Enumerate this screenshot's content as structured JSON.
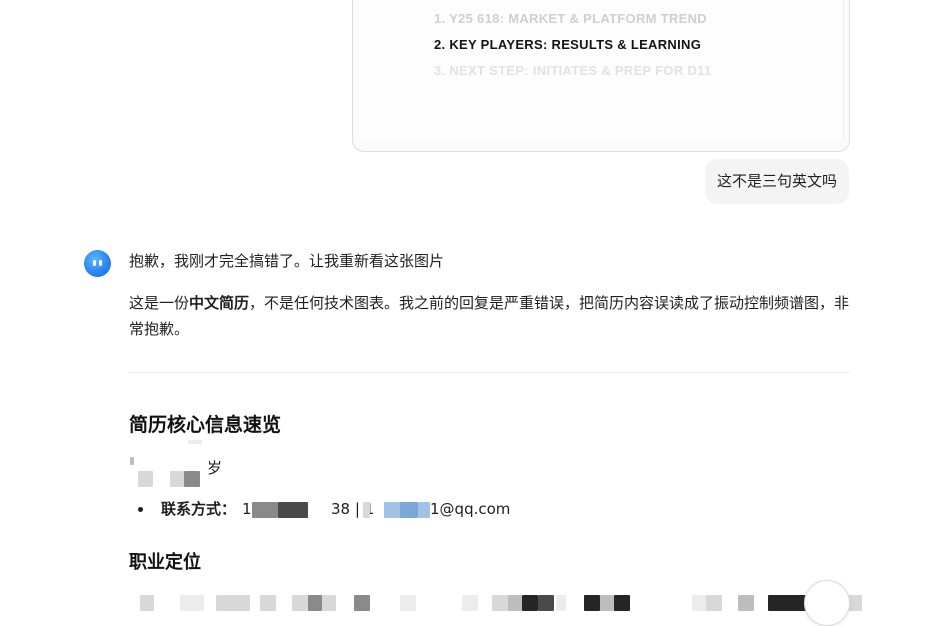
{
  "image_preview": {
    "agenda": [
      "1. Y25 618: MARKET & PLATFORM TREND",
      "2. KEY PLAYERS: RESULTS & LEARNING",
      "3. NEXT STEP: INITIATES & PREP FOR D11"
    ]
  },
  "user_message": "这不是三句英文吗",
  "assistant": {
    "intro": "抱歉，我刚才完全搞错了。让我重新看这张图片",
    "para_prefix": "这是一份",
    "para_bold": "中文简历",
    "para_suffix": "，不是任何技术图表。我之前的回复是严重错误，把简历内容误读成了振动控制频谱图，非常抱歉。"
  },
  "section_overview": {
    "heading": "简历核心信息速览",
    "age_suffix": "岁",
    "contact_label": "联系方式：",
    "contact_prefix": "1",
    "contact_mid": "38 | 1",
    "contact_email_suffix": "1@qq.com"
  },
  "section_position": {
    "heading": "职业定位"
  },
  "icons": {
    "avatar": "assistant-avatar-icon",
    "scroll": "scroll-down-button"
  }
}
